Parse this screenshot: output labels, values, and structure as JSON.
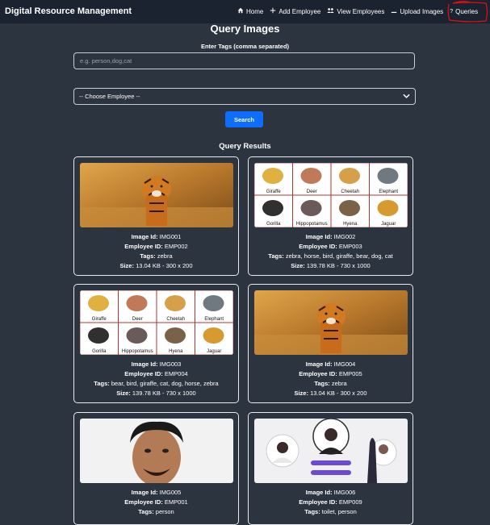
{
  "nav": {
    "brand": "Digital Resource Management",
    "links": [
      {
        "icon": "home-icon",
        "label": "Home"
      },
      {
        "icon": "plus-icon",
        "label": "Add Employee"
      },
      {
        "icon": "people-icon",
        "label": "View Employees"
      },
      {
        "icon": "upload-icon",
        "label": "Upload Images"
      },
      {
        "icon": "question-icon",
        "label": "Queries"
      }
    ]
  },
  "form": {
    "title": "Query Images",
    "tags_label": "Enter Tags (comma separated)",
    "tags_placeholder": "e.g. person,dog,cat",
    "employee_select": "-- Choose Employee --",
    "search_label": "Search"
  },
  "results": {
    "title": "Query Results",
    "labels": {
      "image_id": "Image Id:",
      "employee_id": "Employee ID:",
      "tags": "Tags:",
      "size": "Size:"
    },
    "cards": [
      {
        "image_id": "IMG001",
        "employee_id": "EMP002",
        "tags": "zebra",
        "size": "13.04 KB - 300 x 200",
        "image": "tiger-photo"
      },
      {
        "image_id": "IMG002",
        "employee_id": "EMP003",
        "tags": "zebra, horse, bird, giraffe, bear, dog, cat",
        "size": "139.78 KB - 730 x 1000",
        "image": "animal-chart"
      },
      {
        "image_id": "IMG003",
        "employee_id": "EMP004",
        "tags": "bear, bird, giraffe, cat, dog, horse, zebra",
        "size": "139.78 KB - 730 x 1000",
        "image": "animal-chart"
      },
      {
        "image_id": "IMG004",
        "employee_id": "EMP005",
        "tags": "zebra",
        "size": "13.04 KB - 300 x 200",
        "image": "tiger-photo"
      },
      {
        "image_id": "IMG005",
        "employee_id": "EMP001",
        "tags": "person",
        "size": "",
        "image": "person-photo"
      },
      {
        "image_id": "IMG006",
        "employee_id": "EMP009",
        "tags": "toilet, person",
        "size": "",
        "image": "people-illustration"
      }
    ],
    "chart_animals": [
      "Giraffe",
      "Deer",
      "Cheetah",
      "Elephant",
      "Gorilla",
      "Hippopotamus",
      "Hyena",
      "Jaguar"
    ]
  }
}
